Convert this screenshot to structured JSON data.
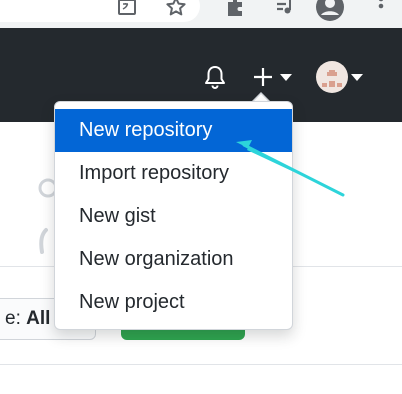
{
  "browser": {
    "toolbar_icons": [
      "translate-icon",
      "bookmark-star-icon",
      "extensions-icon",
      "media-icon",
      "profile-icon",
      "kebab-menu-icon"
    ]
  },
  "header": {
    "icons": [
      "notification-bell-icon",
      "plus-icon",
      "caret-down-icon",
      "avatar",
      "caret-down-icon"
    ]
  },
  "dropdown": {
    "items": [
      {
        "label": "New repository",
        "active": true
      },
      {
        "label": "Import repository",
        "active": false
      },
      {
        "label": "New gist",
        "active": false
      },
      {
        "label": "New organization",
        "active": false
      },
      {
        "label": "New project",
        "active": false
      }
    ]
  },
  "filter": {
    "label": "e:",
    "value": "All"
  },
  "colors": {
    "header_bg": "#24292e",
    "active_item": "#0366d6",
    "green_button": "#2ea44f",
    "annotation_arrow": "#2dd4da"
  }
}
